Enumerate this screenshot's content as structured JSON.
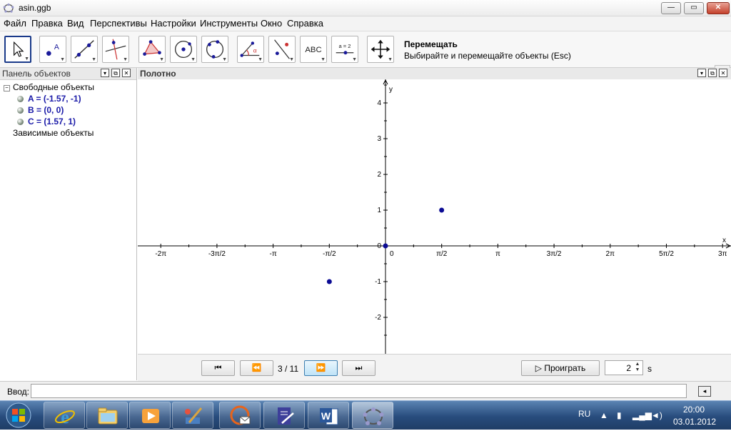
{
  "window": {
    "title": "asin.ggb",
    "min_label": "—",
    "max_label": "▭",
    "close_label": "✕"
  },
  "menu": [
    "Файл",
    "Правка",
    "Вид",
    "Перспективы",
    "Настройки",
    "Инструменты",
    "Окно",
    "Справка"
  ],
  "toolbar": {
    "help_name": "Перемещать",
    "help_desc": "Выбирайте и перемещайте объекты (Esc)",
    "text_tool_label": "ABC",
    "slider_tool_label": "a = 2",
    "undo_icon": "undo-arrow-icon",
    "redo_icon": "redo-arrow-icon"
  },
  "algebra": {
    "title": "Панель объектов",
    "free_title": "Свободные объекты",
    "free_toggle": "−",
    "items": [
      "A = (-1.57, -1)",
      "B = (0, 0)",
      "C = (1.57, 1)"
    ],
    "dependent_title": "Зависимые объекты"
  },
  "graphics": {
    "title": "Полотно",
    "x_axis_label": "x",
    "y_axis_label": "y",
    "origin_label": "0",
    "x_ticks": [
      {
        "value": -6.2832,
        "label": "-2π"
      },
      {
        "value": -4.7124,
        "label": "-3π/2"
      },
      {
        "value": -3.1416,
        "label": "-π"
      },
      {
        "value": -1.5708,
        "label": "-π/2"
      },
      {
        "value": 0,
        "label": "0"
      },
      {
        "value": 1.5708,
        "label": "π/2"
      },
      {
        "value": 3.1416,
        "label": "π"
      },
      {
        "value": 4.7124,
        "label": "3π/2"
      },
      {
        "value": 6.2832,
        "label": "2π"
      },
      {
        "value": 7.854,
        "label": "5π/2"
      },
      {
        "value": 9.4248,
        "label": "3π"
      }
    ],
    "y_ticks": [
      {
        "value": 4,
        "label": "4"
      },
      {
        "value": 3,
        "label": "3"
      },
      {
        "value": 2,
        "label": "2"
      },
      {
        "value": 1,
        "label": "1"
      },
      {
        "value": 0,
        "label": "0"
      },
      {
        "value": -1,
        "label": "-1"
      },
      {
        "value": -2,
        "label": "-2"
      }
    ],
    "points": [
      {
        "name": "A",
        "x": -1.57,
        "y": -1
      },
      {
        "name": "B",
        "x": 0,
        "y": 0
      },
      {
        "name": "C",
        "x": 1.57,
        "y": 1
      }
    ],
    "point_color": "#0b0b94"
  },
  "animation": {
    "page": "3 / 11",
    "play_label": "Проиграть",
    "speed": "2",
    "speed_unit": "s",
    "first_icon": "⏮",
    "prev_icon": "⏪",
    "next_icon": "⏩",
    "last_icon": "⏭"
  },
  "input": {
    "label": "Ввод:",
    "value": "",
    "keyboard_icon": "◂"
  },
  "taskbar": {
    "lang": "RU",
    "time": "20:00",
    "date": "03.01.2012",
    "apps": [
      "internet-explorer-icon",
      "file-explorer-icon",
      "media-player-icon",
      "paint-tool-icon",
      "mail-app-icon",
      "notepad-pen-icon",
      "word-icon",
      "geogebra-icon"
    ]
  }
}
